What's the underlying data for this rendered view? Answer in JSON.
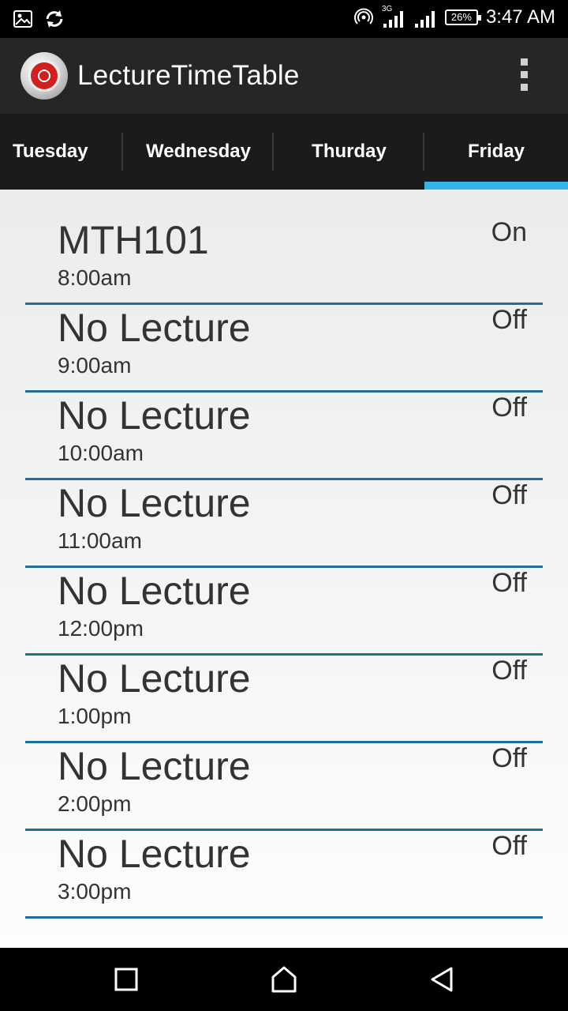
{
  "status_bar": {
    "time": "3:47 AM",
    "battery_percent": "26%",
    "network_type": "3G",
    "icons": [
      "image-icon",
      "sync-icon",
      "hotspot-icon",
      "signal-icon",
      "signal-icon",
      "battery-icon"
    ]
  },
  "app_bar": {
    "title": "LectureTimeTable",
    "logo_icon": "alarm-clock-icon",
    "menu_icon": "overflow-menu-icon"
  },
  "tabs": [
    {
      "label": "Tuesday",
      "selected": false
    },
    {
      "label": "Wednesday",
      "selected": false
    },
    {
      "label": "Thurday",
      "selected": false
    },
    {
      "label": "Friday",
      "selected": true
    }
  ],
  "accent_color": "#33b5e5",
  "divider_color": "#1e6f9a",
  "slots": [
    {
      "lecture": "MTH101",
      "time": "8:00am",
      "state": "On"
    },
    {
      "lecture": "No Lecture",
      "time": "9:00am",
      "state": "Off"
    },
    {
      "lecture": "No Lecture",
      "time": "10:00am",
      "state": "Off"
    },
    {
      "lecture": "No Lecture",
      "time": "11:00am",
      "state": "Off"
    },
    {
      "lecture": "No Lecture",
      "time": "12:00pm",
      "state": "Off"
    },
    {
      "lecture": "No Lecture",
      "time": "1:00pm",
      "state": "Off"
    },
    {
      "lecture": "No Lecture",
      "time": "2:00pm",
      "state": "Off"
    },
    {
      "lecture": "No Lecture",
      "time": "3:00pm",
      "state": "Off"
    }
  ],
  "nav_bar": {
    "icons": [
      "recents-icon",
      "home-icon",
      "back-icon"
    ]
  }
}
